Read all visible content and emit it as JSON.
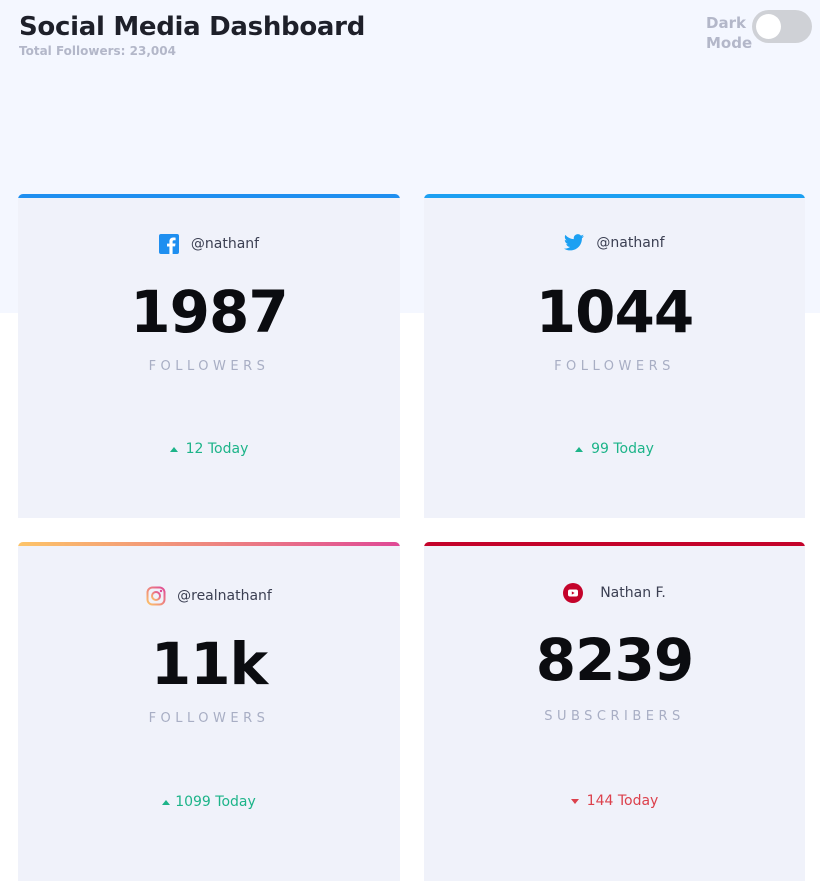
{
  "header": {
    "title": "Social Media Dashboard",
    "subtitle": "Total Followers: 23,004",
    "dark_mode_label_1": "Dark",
    "dark_mode_label_2": "Mode",
    "dark_mode_on": false
  },
  "cards": [
    {
      "platform_icon": "facebook-icon",
      "handle": "@nathanf",
      "count": "1987",
      "unit": "FOLLOWERS",
      "change": "12 Today",
      "direction": "up",
      "accent": "#1f8ff0"
    },
    {
      "platform_icon": "twitter-icon",
      "handle": "@nathanf",
      "count": "1044",
      "unit": "FOLLOWERS",
      "change": "99 Today",
      "direction": "up",
      "accent": "#1ca0f2"
    },
    {
      "platform_icon": "instagram-icon",
      "handle": "@realnathanf",
      "count": "11k",
      "unit": "FOLLOWERS",
      "change": "1099 Today",
      "direction": "up",
      "accent": "#df4996"
    },
    {
      "platform_icon": "youtube-icon",
      "handle": "Nathan F.",
      "count": "8239",
      "unit": "SUBSCRIBERS",
      "change": "144 Today",
      "direction": "down",
      "accent": "#c4032b"
    }
  ],
  "colors": {
    "up": "#1db489",
    "down": "#dc414c",
    "background_top": "#f4f7ff",
    "card": "#f0f2fa"
  }
}
